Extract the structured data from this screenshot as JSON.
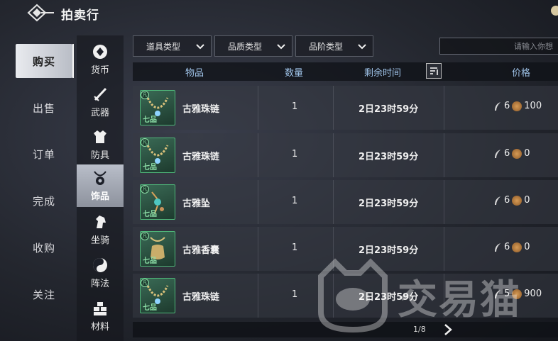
{
  "header": {
    "title": "拍卖行"
  },
  "left_nav": [
    {
      "label": "购买",
      "active": true
    },
    {
      "label": "出售",
      "active": false
    },
    {
      "label": "订单",
      "active": false
    },
    {
      "label": "完成",
      "active": false
    },
    {
      "label": "收购",
      "active": false
    },
    {
      "label": "关注",
      "active": false
    }
  ],
  "categories": [
    {
      "label": "货币",
      "icon": "coin-icon",
      "active": false
    },
    {
      "label": "武器",
      "icon": "sword-icon",
      "active": false
    },
    {
      "label": "防具",
      "icon": "armor-icon",
      "active": false
    },
    {
      "label": "饰品",
      "icon": "necklace-icon",
      "active": true
    },
    {
      "label": "坐骑",
      "icon": "horse-icon",
      "active": false
    },
    {
      "label": "阵法",
      "icon": "formation-icon",
      "active": false
    },
    {
      "label": "材料",
      "icon": "material-icon",
      "active": false
    }
  ],
  "filters": [
    {
      "label": "道具类型"
    },
    {
      "label": "品质类型"
    },
    {
      "label": "品阶类型"
    }
  ],
  "search": {
    "placeholder": "请输入你想"
  },
  "table": {
    "headers": {
      "item": "物品",
      "qty": "数量",
      "time": "剩余时间",
      "price": "价格"
    },
    "rows": [
      {
        "name": "古雅珠链",
        "qty": "1",
        "time": "2日23时59分",
        "feather": "6",
        "coin": "100",
        "quality": "七品",
        "ring": "凡",
        "type": "necklace"
      },
      {
        "name": "古雅珠链",
        "qty": "1",
        "time": "2日23时59分",
        "feather": "6",
        "coin": "0",
        "quality": "七品",
        "ring": "凡",
        "type": "necklace"
      },
      {
        "name": "古雅坠",
        "qty": "1",
        "time": "2日23时59分",
        "feather": "6",
        "coin": "0",
        "quality": "七品",
        "ring": "凡",
        "type": "pendant"
      },
      {
        "name": "古雅香囊",
        "qty": "1",
        "time": "2日23时59分",
        "feather": "6",
        "coin": "0",
        "quality": "七品",
        "ring": "凡",
        "type": "sachet"
      },
      {
        "name": "古雅珠链",
        "qty": "1",
        "time": "2日23时59分",
        "feather": "5",
        "coin": "900",
        "quality": "七品",
        "ring": "凡",
        "type": "necklace"
      }
    ]
  },
  "pager": {
    "text": "1/8"
  },
  "watermark": {
    "text": "交易猫"
  },
  "colors": {
    "header_text": "#9fc3e8",
    "quality_green": "#4fb87a",
    "active_tab": "#e9ebef"
  }
}
